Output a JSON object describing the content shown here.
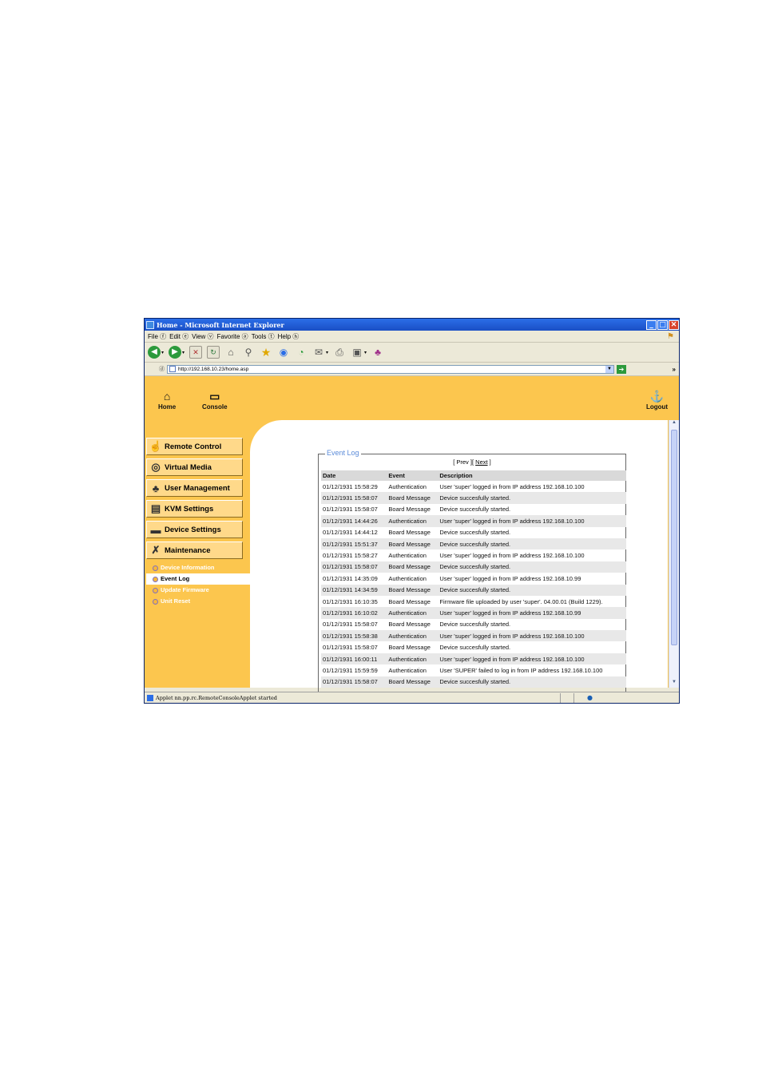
{
  "window": {
    "title": "Home - Microsoft Internet Explorer",
    "min": "_",
    "max": "□",
    "close": "✕"
  },
  "menubar": [
    "File ⓕ",
    "Edit ⓔ",
    "View ⓥ",
    "Favorite ⓐ",
    "Tools ⓣ",
    "Help ⓗ"
  ],
  "address": {
    "label": "ⓓ",
    "url": "http://192.168.10.23/home.asp",
    "more": "»"
  },
  "topnav": {
    "home": "Home",
    "console": "Console",
    "logout": "Logout"
  },
  "sidebar": {
    "items": [
      "Remote Control",
      "Virtual Media",
      "User Management",
      "KVM Settings",
      "Device Settings",
      "Maintenance"
    ],
    "subitems": [
      "Device Information",
      "Event Log",
      "Update Firmware",
      "Unit Reset"
    ]
  },
  "event_log": {
    "legend": "Event Log",
    "prev": "[ Prev ][",
    "next": "Next",
    "close_bracket": "]",
    "headers": [
      "Date",
      "Event",
      "Description"
    ],
    "rows": [
      [
        "01/12/1931 15:58:29",
        "Authentication",
        "User 'super' logged in from IP address 192.168.10.100"
      ],
      [
        "01/12/1931 15:58:07",
        "Board Message",
        "Device succesfully started."
      ],
      [
        "01/12/1931 15:58:07",
        "Board Message",
        "Device succesfully started."
      ],
      [
        "01/12/1931 14:44:26",
        "Authentication",
        "User 'super' logged in from IP address 192.168.10.100"
      ],
      [
        "01/12/1931 14:44:12",
        "Board Message",
        "Device succesfully started."
      ],
      [
        "01/12/1931 15:51:37",
        "Board Message",
        "Device succesfully started."
      ],
      [
        "01/12/1931 15:58:27",
        "Authentication",
        "User 'super' logged in from IP address 192.168.10.100"
      ],
      [
        "01/12/1931 15:58:07",
        "Board Message",
        "Device succesfully started."
      ],
      [
        "01/12/1931 14:35:09",
        "Authentication",
        "User 'super' logged in from IP address 192.168.10.99"
      ],
      [
        "01/12/1931 14:34:59",
        "Board Message",
        "Device succesfully started."
      ],
      [
        "01/12/1931 16:10:35",
        "Board Message",
        "Firmware file uploaded by user 'super'. 04.00.01 (Build 1229)."
      ],
      [
        "01/12/1931 16:10:02",
        "Authentication",
        "User 'super' logged in from IP address 192.168.10.99"
      ],
      [
        "01/12/1931 15:58:07",
        "Board Message",
        "Device succesfully started."
      ],
      [
        "01/12/1931 15:58:38",
        "Authentication",
        "User 'super' logged in from IP address 192.168.10.100"
      ],
      [
        "01/12/1931 15:58:07",
        "Board Message",
        "Device succesfully started."
      ],
      [
        "01/12/1931 16:00:11",
        "Authentication",
        "User 'super' logged in from IP address 192.168.10.100"
      ],
      [
        "01/12/1931 15:59:59",
        "Authentication",
        "User 'SUPER' failed to log in from IP address 192.168.10.100"
      ],
      [
        "01/12/1931 15:58:07",
        "Board Message",
        "Device succesfully started."
      ]
    ]
  },
  "status": {
    "text": "Applet nn.pp.rc.RemoteConsoleApplet started"
  },
  "colors": {
    "page_bg": "#fcc64e",
    "legend": "#5b8bd9",
    "titlebar": "#2b6ee8"
  }
}
